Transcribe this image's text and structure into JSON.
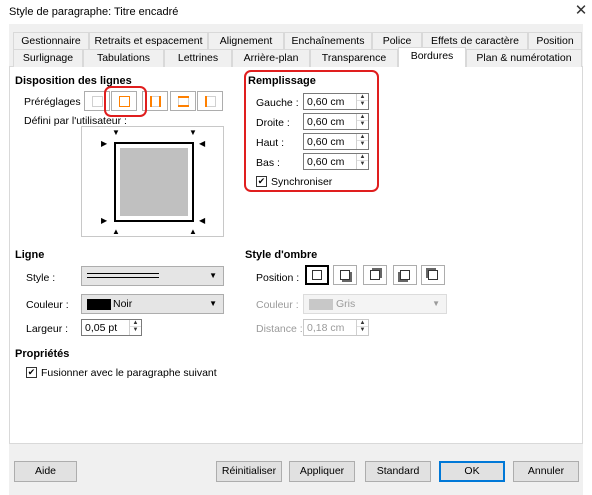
{
  "window": {
    "title": "Style de paragraphe: Titre encadré",
    "close_glyph": "✕"
  },
  "tabs": {
    "row1": [
      {
        "label": "Gestionnaire"
      },
      {
        "label": "Retraits et espacement"
      },
      {
        "label": "Alignement"
      },
      {
        "label": "Enchaînements"
      },
      {
        "label": "Police"
      },
      {
        "label": "Effets de caractère"
      },
      {
        "label": "Position"
      }
    ],
    "row2": [
      {
        "label": "Surlignage"
      },
      {
        "label": "Tabulations"
      },
      {
        "label": "Lettrines"
      },
      {
        "label": "Arrière-plan"
      },
      {
        "label": "Transparence"
      },
      {
        "label": "Bordures",
        "active": true
      },
      {
        "label": "Plan & numérotation"
      }
    ]
  },
  "line_arrangement": {
    "title": "Disposition des lignes",
    "presets_label": "Préréglages :",
    "user_defined_label": "Défini par l'utilisateur :",
    "selected_preset_index": 1
  },
  "padding": {
    "title": "Remplissage",
    "left_label": "Gauche :",
    "left_value": "0,60 cm",
    "right_label": "Droite :",
    "right_value": "0,60 cm",
    "top_label": "Haut :",
    "top_value": "0,60 cm",
    "bottom_label": "Bas :",
    "bottom_value": "0,60 cm",
    "sync_label": "Synchroniser",
    "sync_checked": true
  },
  "line": {
    "title": "Ligne",
    "style_label": "Style :",
    "color_label": "Couleur :",
    "color_value": "Noir",
    "color_swatch": "#000000",
    "width_label": "Largeur :",
    "width_value": "0,05 pt"
  },
  "shadow": {
    "title": "Style d'ombre",
    "position_label": "Position :",
    "color_label": "Couleur :",
    "color_value": "Gris",
    "color_swatch": "#c0c0c0",
    "distance_label": "Distance :",
    "distance_value": "0,18 cm"
  },
  "properties": {
    "title": "Propriétés",
    "merge_label": "Fusionner avec le paragraphe suivant",
    "merge_checked": true
  },
  "buttons": {
    "help": "Aide",
    "reset": "Réinitialiser",
    "apply": "Appliquer",
    "standard": "Standard",
    "ok": "OK",
    "cancel": "Annuler"
  },
  "colors": {
    "highlight_red": "#e01e1e",
    "preset_orange": "#ff8000",
    "default_button_blue": "#0078d7"
  }
}
